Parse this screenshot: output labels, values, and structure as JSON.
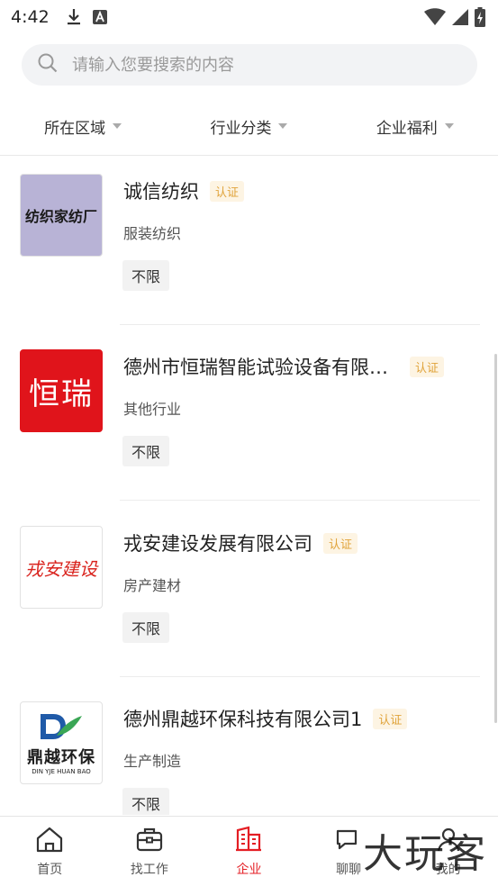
{
  "status_bar": {
    "time": "4:42"
  },
  "search": {
    "placeholder": "请输入您要搜索的内容"
  },
  "filters": [
    {
      "label": "所在区域"
    },
    {
      "label": "行业分类"
    },
    {
      "label": "企业福利"
    }
  ],
  "companies": [
    {
      "name": "诚信纺织",
      "cert": "认证",
      "industry": "服装纺织",
      "tag": "不限",
      "logo_text": "纺织家纺厂",
      "logo_bg": "#b8b3d6",
      "logo_color": "#1a1a1a"
    },
    {
      "name": "德州市恒瑞智能试验设备有限…",
      "cert": "认证",
      "industry": "其他行业",
      "tag": "不限",
      "logo_text": "恒瑞",
      "logo_bg": "#e0141b",
      "logo_color": "#ffffff"
    },
    {
      "name": "戎安建设发展有限公司",
      "cert": "认证",
      "industry": "房产建材",
      "tag": "不限",
      "logo_text": "戎安建设",
      "logo_bg": "#ffffff",
      "logo_color": "#d9231d"
    },
    {
      "name": "德州鼎越环保科技有限公司1",
      "cert": "认证",
      "industry": "生产制造",
      "tag": "不限",
      "logo_text": "鼎越环保",
      "logo_subtext": "DIN YJE HUAN BAO",
      "logo_bg": "#ffffff",
      "logo_color": "#1d1d1d"
    }
  ],
  "bottom_nav": [
    {
      "label": "首页",
      "icon": "home-icon"
    },
    {
      "label": "找工作",
      "icon": "briefcase-icon"
    },
    {
      "label": "企业",
      "icon": "building-icon",
      "active": true
    },
    {
      "label": "聊聊",
      "icon": "chat-icon"
    },
    {
      "label": "我的",
      "icon": "user-icon"
    }
  ],
  "watermark": "大玩客",
  "colors": {
    "accent": "#e41e24",
    "cert_text": "#e0a33a",
    "cert_bg": "#fdf4e3"
  }
}
